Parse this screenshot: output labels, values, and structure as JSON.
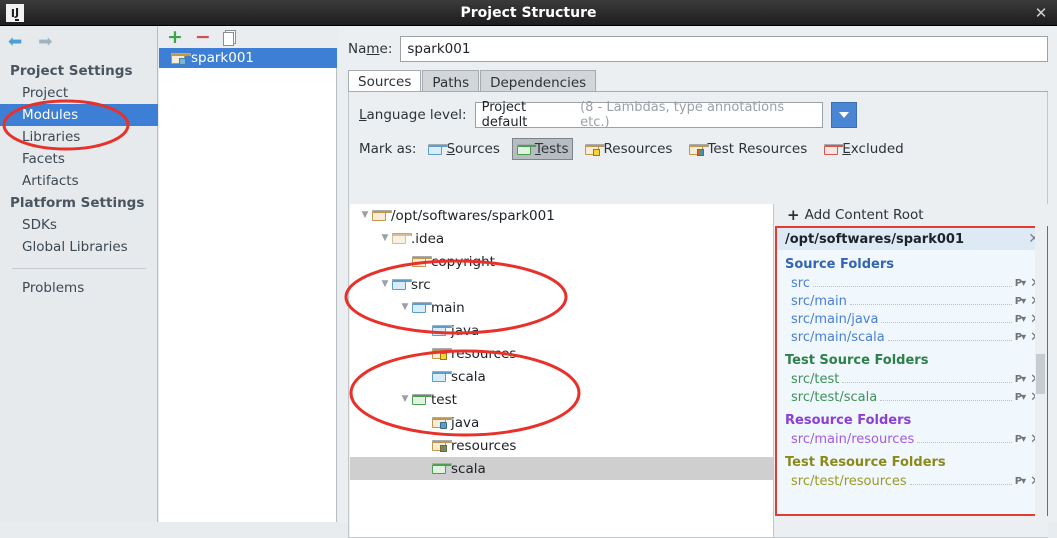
{
  "window": {
    "title": "Project Structure",
    "app_icon": "IJ",
    "close_icon": "✕"
  },
  "sidebar": {
    "nav": {
      "back_icon": "⬅",
      "forward_icon": "➡"
    },
    "groups": [
      {
        "label": "Project Settings",
        "items": [
          {
            "label": "Project",
            "selected": false
          },
          {
            "label": "Modules",
            "selected": true
          },
          {
            "label": "Libraries",
            "selected": false
          },
          {
            "label": "Facets",
            "selected": false
          },
          {
            "label": "Artifacts",
            "selected": false
          }
        ]
      },
      {
        "label": "Platform Settings",
        "items": [
          {
            "label": "SDKs",
            "selected": false
          },
          {
            "label": "Global Libraries",
            "selected": false
          }
        ]
      }
    ],
    "problems": "Problems"
  },
  "modules_panel": {
    "toolbar": {
      "add_icon": "+",
      "remove_icon": "−",
      "copy_icon": "copy-icon"
    },
    "selected_module": "spark001"
  },
  "main": {
    "name_label": "Name:",
    "name_value": "spark001",
    "tabs": [
      {
        "label": "Sources",
        "active": true
      },
      {
        "label": "Paths",
        "active": false
      },
      {
        "label": "Dependencies",
        "active": false
      }
    ],
    "language_level": {
      "label": "Language level:",
      "value": "Project default",
      "hint": "(8 - Lambdas, type annotations etc.)"
    },
    "mark_as": {
      "label": "Mark as:",
      "buttons": [
        {
          "label": "Sources",
          "icon": "folder-blue",
          "active": false
        },
        {
          "label": "Tests",
          "icon": "folder-green",
          "active": true
        },
        {
          "label": "Resources",
          "icon": "folder-tan-grid",
          "active": false
        },
        {
          "label": "Test Resources",
          "icon": "folder-tan-multi",
          "active": false
        },
        {
          "label": "Excluded",
          "icon": "folder-red",
          "active": false
        }
      ]
    },
    "tree": [
      {
        "label": "/opt/softwares/spark001",
        "depth": 0,
        "twisty": "▼",
        "icon": "folder-tan",
        "selected": false
      },
      {
        "label": ".idea",
        "depth": 1,
        "twisty": "▼",
        "icon": "folder-tan-light",
        "selected": false
      },
      {
        "label": "copyright",
        "depth": 2,
        "twisty": "",
        "icon": "folder-tan",
        "selected": false
      },
      {
        "label": "src",
        "depth": 1,
        "twisty": "▼",
        "icon": "folder-blue",
        "selected": false
      },
      {
        "label": "main",
        "depth": 2,
        "twisty": "▼",
        "icon": "folder-blue",
        "selected": false
      },
      {
        "label": "java",
        "depth": 3,
        "twisty": "",
        "icon": "folder-blue",
        "selected": false
      },
      {
        "label": "resources",
        "depth": 3,
        "twisty": "",
        "icon": "folder-tan-grid",
        "selected": false
      },
      {
        "label": "scala",
        "depth": 3,
        "twisty": "",
        "icon": "folder-blue",
        "selected": false
      },
      {
        "label": "test",
        "depth": 2,
        "twisty": "▼",
        "icon": "folder-green",
        "selected": false
      },
      {
        "label": "java",
        "depth": 3,
        "twisty": "",
        "icon": "folder-tan-dot",
        "selected": false
      },
      {
        "label": "resources",
        "depth": 3,
        "twisty": "",
        "icon": "folder-tan-multi",
        "selected": false
      },
      {
        "label": "scala",
        "depth": 3,
        "twisty": "",
        "icon": "folder-green",
        "selected": true
      }
    ],
    "roots": {
      "add_content_root": "Add Content Root",
      "add_icon": "+",
      "content_root": "/opt/softwares/spark001",
      "close_icon": "✕",
      "sections": [
        {
          "title": "Source Folders",
          "kind": "source",
          "folders": [
            "src",
            "src/main",
            "src/main/java",
            "src/main/scala"
          ]
        },
        {
          "title": "Test Source Folders",
          "kind": "test",
          "folders": [
            "src/test",
            "src/test/scala"
          ]
        },
        {
          "title": "Resource Folders",
          "kind": "res",
          "folders": [
            "src/main/resources"
          ]
        },
        {
          "title": "Test Resource Folders",
          "kind": "testres",
          "folders": [
            "src/test/resources"
          ]
        }
      ],
      "row_icons": {
        "package_prefix": "P▾",
        "remove": "✕"
      }
    }
  },
  "annotations": {
    "color": "#e8312a",
    "ellipses": [
      "modules-sidebar-item",
      "main-source-folders",
      "test-source-folders",
      "roots-panel-outline"
    ]
  }
}
